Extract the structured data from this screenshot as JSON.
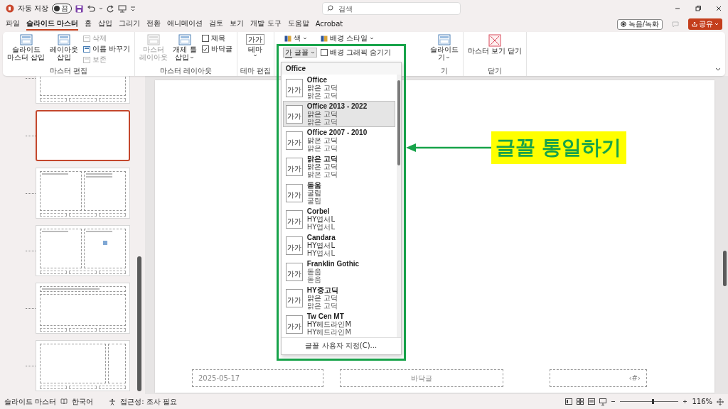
{
  "titlebar": {
    "autosave_label": "자동 저장",
    "autosave": {
      "on": false,
      "label": "끔"
    },
    "search": {
      "placeholder": "검색"
    }
  },
  "menu_tabs": [
    {
      "label": "파일",
      "selected": false
    },
    {
      "label": "슬라이드 마스터",
      "selected": true
    },
    {
      "label": "홈",
      "selected": false
    },
    {
      "label": "삽입",
      "selected": false
    },
    {
      "label": "그리기",
      "selected": false
    },
    {
      "label": "전환",
      "selected": false
    },
    {
      "label": "애니메이션",
      "selected": false
    },
    {
      "label": "검토",
      "selected": false
    },
    {
      "label": "보기",
      "selected": false
    },
    {
      "label": "개발 도구",
      "selected": false
    },
    {
      "label": "도움말",
      "selected": false
    },
    {
      "label": "Acrobat",
      "selected": false
    }
  ],
  "record_button": "녹음/녹화",
  "share_button": "공유",
  "ribbon": {
    "groups": [
      {
        "label": "마스터 편집",
        "items": [
          {
            "kind": "large",
            "lines": [
              "슬라이드",
              "마스터 삽입"
            ],
            "disabled": false
          },
          {
            "kind": "large",
            "lines": [
              "레이아웃",
              "삽입"
            ],
            "disabled": false
          },
          {
            "kind": "stack",
            "entries": [
              {
                "kind": "button",
                "label": "삭제",
                "disabled": true
              },
              {
                "kind": "button",
                "label": "이름 바꾸기",
                "disabled": false
              },
              {
                "kind": "button",
                "label": "보존",
                "disabled": true
              }
            ]
          }
        ]
      },
      {
        "label": "마스터 레이아웃",
        "items": [
          {
            "kind": "large",
            "lines": [
              "마스터",
              "레이아웃"
            ],
            "disabled": true
          },
          {
            "kind": "large",
            "lines": [
              "개체 틀",
              "삽입"
            ],
            "disabled": false,
            "dropdown": true
          },
          {
            "kind": "stack",
            "entries": [
              {
                "kind": "checkbox",
                "label": "제목",
                "checked": false
              },
              {
                "kind": "checkbox",
                "label": "바닥글",
                "checked": true
              }
            ]
          }
        ]
      },
      {
        "label": "테마 편집",
        "items": [
          {
            "kind": "theme",
            "preview": "가가",
            "lines": [
              "테마"
            ],
            "dropdown": true
          }
        ]
      },
      {
        "items": [
          {
            "kind": "stack",
            "entries": [
              {
                "kind": "menu",
                "label": "색"
              },
              {
                "kind": "font-menu",
                "preview": "가",
                "label": "글꼴",
                "open": true
              }
            ]
          },
          {
            "kind": "stack",
            "entries": [
              {
                "kind": "menu",
                "label": "배경 스타일"
              },
              {
                "kind": "checkbox",
                "label": "배경 그래픽 숨기기",
                "checked": false
              }
            ]
          }
        ]
      },
      {
        "label": "기",
        "items": [
          {
            "kind": "large",
            "lines": [
              "슬라이드",
              "기"
            ],
            "disabled": false,
            "dropdown": true
          }
        ]
      },
      {
        "label": "닫기",
        "items": [
          {
            "kind": "close",
            "lines": [
              "마스터 보기 닫기"
            ]
          }
        ]
      }
    ]
  },
  "font_dropdown": {
    "header": "Office",
    "items": [
      {
        "preview": "가가",
        "name": "Office",
        "heading_font": "맑은 고딕",
        "body_font": "맑은 고딕",
        "selected": false
      },
      {
        "preview": "가가",
        "name": "Office 2013 - 2022",
        "heading_font": "맑은 고딕",
        "body_font": "맑은 고딕",
        "selected": true
      },
      {
        "preview": "가가",
        "name": "Office 2007 - 2010",
        "heading_font": "맑은 고딕",
        "body_font": "맑은 고딕",
        "selected": false
      },
      {
        "preview": "가가",
        "name": "맑은 고딕",
        "heading_font": "맑은 고딕",
        "body_font": "맑은 고딕",
        "selected": false
      },
      {
        "preview": "가가",
        "name": "돋움",
        "heading_font": "굴림",
        "body_font": "굴림",
        "selected": false
      },
      {
        "preview": "가가",
        "name": "Corbel",
        "heading_font": "HY엽서L",
        "body_font": "HY엽서L",
        "selected": false
      },
      {
        "preview": "가가",
        "name": "Candara",
        "heading_font": "HY엽서L",
        "body_font": "HY엽서L",
        "selected": false
      },
      {
        "preview": "가가",
        "name": "Franklin Gothic",
        "heading_font": "돋움",
        "body_font": "돋움",
        "selected": false
      },
      {
        "preview": "가가",
        "name": "HY중고딕",
        "heading_font": "맑은 고딕",
        "body_font": "맑은 고딕",
        "selected": false
      },
      {
        "preview": "가가",
        "name": "Tw Cen MT",
        "heading_font": "HY헤드라인M",
        "body_font": "HY헤드라인M",
        "selected": false
      }
    ],
    "footer": "글꼴 사용자 지정(C)..."
  },
  "thumbnails": [
    {
      "kind": "title",
      "selected": false
    },
    {
      "kind": "blank",
      "selected": true
    },
    {
      "kind": "two-content",
      "selected": false
    },
    {
      "kind": "picture",
      "selected": false
    },
    {
      "kind": "title-vertical",
      "selected": false
    },
    {
      "kind": "vertical",
      "selected": false
    }
  ],
  "slide": {
    "date": "2025-05-17",
    "footer": "바닥글",
    "page_number": "‹#›"
  },
  "callout": {
    "label": "글꼴 통일하기"
  },
  "status_bar": {
    "mode": "슬라이드 마스터",
    "language": "한국어",
    "accessibility": "접근성: 조사 필요",
    "zoom": {
      "level": 0.55
    },
    "zoom_reading": "116%"
  }
}
